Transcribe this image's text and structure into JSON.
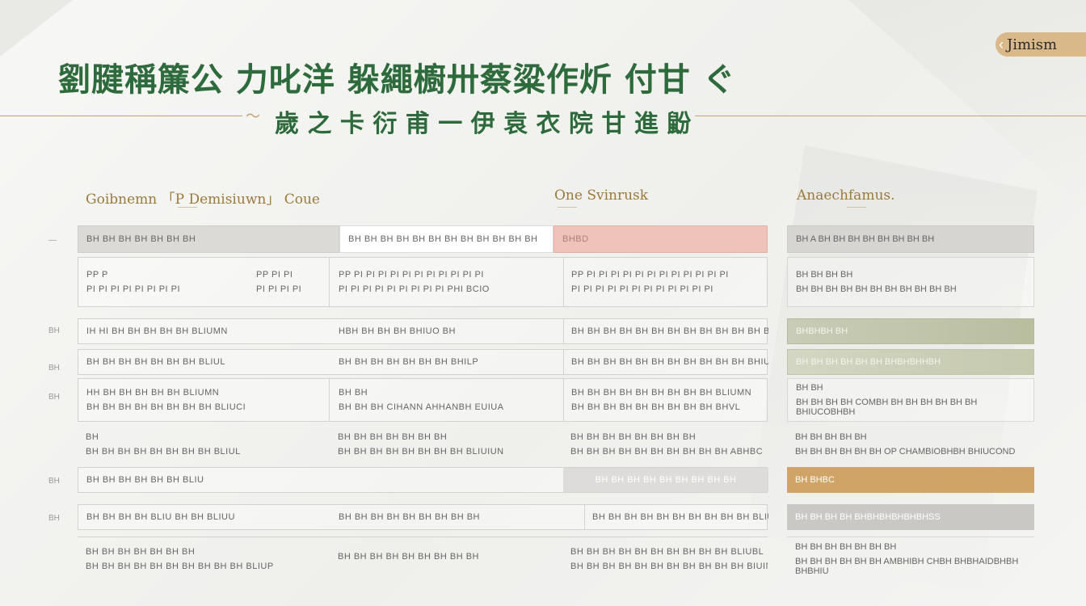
{
  "header": {
    "title": "劉腱稱簾公 力叱洋 躲繩櫥卅蔡粱作炘 付甘 ぐ",
    "subtitle": "歲 之 卡 衍 甫 一 伊 袁 衣 院 甘 進 鼢",
    "brand": "Jimism"
  },
  "columns": {
    "left": {
      "title": "Goibnemn 「P Demisiuwn」 Coue"
    },
    "middle": {
      "title": "One Svinrusk"
    },
    "right": {
      "title": "Anaechfamus."
    }
  },
  "table": {
    "header_row": [
      "BH BH BH BH BH BH BH",
      "BH BH BH BH BH BH BH BH BH BH BH BH",
      "BHBD"
    ],
    "rows": [
      {
        "marker": "",
        "cells": [
          [
            "PP P",
            "PI PI PI PI PI PI PI PI"
          ],
          [
            "PP PI PI",
            "PI PI PI PI"
          ],
          [
            "PP PI PI PI PI PI PI PI PI PI PI PI",
            "PI PI PI PI PI PI PI PI PI PHI BCIO"
          ],
          [
            "PP PI PI PI PI PI PI PI PI PI PI PI PI",
            "PI PI PI PI PI PI PI PI PI PI PI PI"
          ]
        ]
      },
      {
        "marker": "BH",
        "cells": [
          [
            "IH HI BH BH BH BH BH BLIUMN"
          ],
          [
            "HBH BH BH BH BHIUO BH"
          ],
          [
            "BH BH BH BH BH BH BH BH BH BH BH BH BH"
          ]
        ]
      },
      {
        "marker": "BH",
        "cells": [
          [
            "BH BH BH BH BH BH BH BLIUL"
          ],
          [
            "BH BH BH BH BH BH BH BHILP"
          ],
          [
            "BH BH BH BH BH BH BH BH BH BH BH BHIUMK"
          ]
        ]
      },
      {
        "marker": "BH",
        "cells": [
          [
            "HH BH BH BH BH BH BLIUMN",
            "BH BH BH BH BH BH BH BH BLIUCI"
          ],
          [
            "BH BH",
            "BH BH BH CIHANN AHHANBH EUIUA"
          ],
          [
            "BH BH BH BH BH BH BH BH BH BLIUMN",
            "BH BH BH BH BH BH BH BH BH BHVL"
          ]
        ]
      },
      {
        "marker": "",
        "cells": [
          [
            "BH",
            "BH BH BH BH BH BH BH BH BLIUL"
          ],
          [
            "BH BH BH BH BH BH BH",
            "BH BH BH BH BH BH BH BH BLIUIUN"
          ],
          [
            "BH BH BH BH BH BH BH BH",
            "BH BH BH BH BH BH BH BH BH BH ABHBC"
          ]
        ]
      },
      {
        "marker": "BH",
        "cells": [
          [
            "BH BH BH BH BH BH BLIU"
          ],
          [
            "BH BH BH BH BH BH BH BH BH"
          ]
        ]
      },
      {
        "marker": "BH",
        "cells": [
          [
            "BH BH BH BH BLIU BH BH BLIUU"
          ],
          [
            "BH BH BH BH BH BH BH BH BH"
          ],
          [
            "BH BH BH BH BH BH BH BH BH BH BLIUIN"
          ]
        ]
      },
      {
        "marker": "",
        "cells": [
          [
            "BH BH BH BH BH BH BH",
            "BH BH BH BH BH BH BH BH BH BH BLIUP"
          ],
          [
            "BH BH BH BH BH BH BH BH BH",
            ""
          ],
          [
            "BH BH BH BH BH BH BH BH BH BH BLIUBL",
            "BH BH BH BH BH BH BH BH BH BH BH BIUIN"
          ]
        ]
      }
    ]
  },
  "side_panel": [
    {
      "l1": "BH A BH BH BH BH BH BH BH BH",
      "l2": ""
    },
    {
      "l1": "BH BH BH BH",
      "l2": "BH BH BH BH BH BH BH BH BH BH BH"
    },
    {
      "l1": "BHBHBH BH",
      "l2": ""
    },
    {
      "l1": "BH BH BH BH BH BH BHBHBHHBH",
      "l2": ""
    },
    {
      "l1": "BH BH",
      "l2": "BH BH BH BH COMBH BH BH BH BH BH BH BHIUCOBHBH"
    },
    {
      "l1": "BH BH BH BH BH",
      "l2": "BH BH BH BH BH BH OP CHAMBIOBHBH BHIUCOND"
    },
    {
      "l1": "BH BHBC",
      "l2": ""
    },
    {
      "l1": "BH BH BH BH BHBHBHBHBHBHSS",
      "l2": ""
    },
    {
      "l1": "BH BH BH BH BH BH BH",
      "l2": "BH BH BH BH BH BH AMBHIBH CHBH BHBHAIDBHBH BHBHIU"
    }
  ]
}
